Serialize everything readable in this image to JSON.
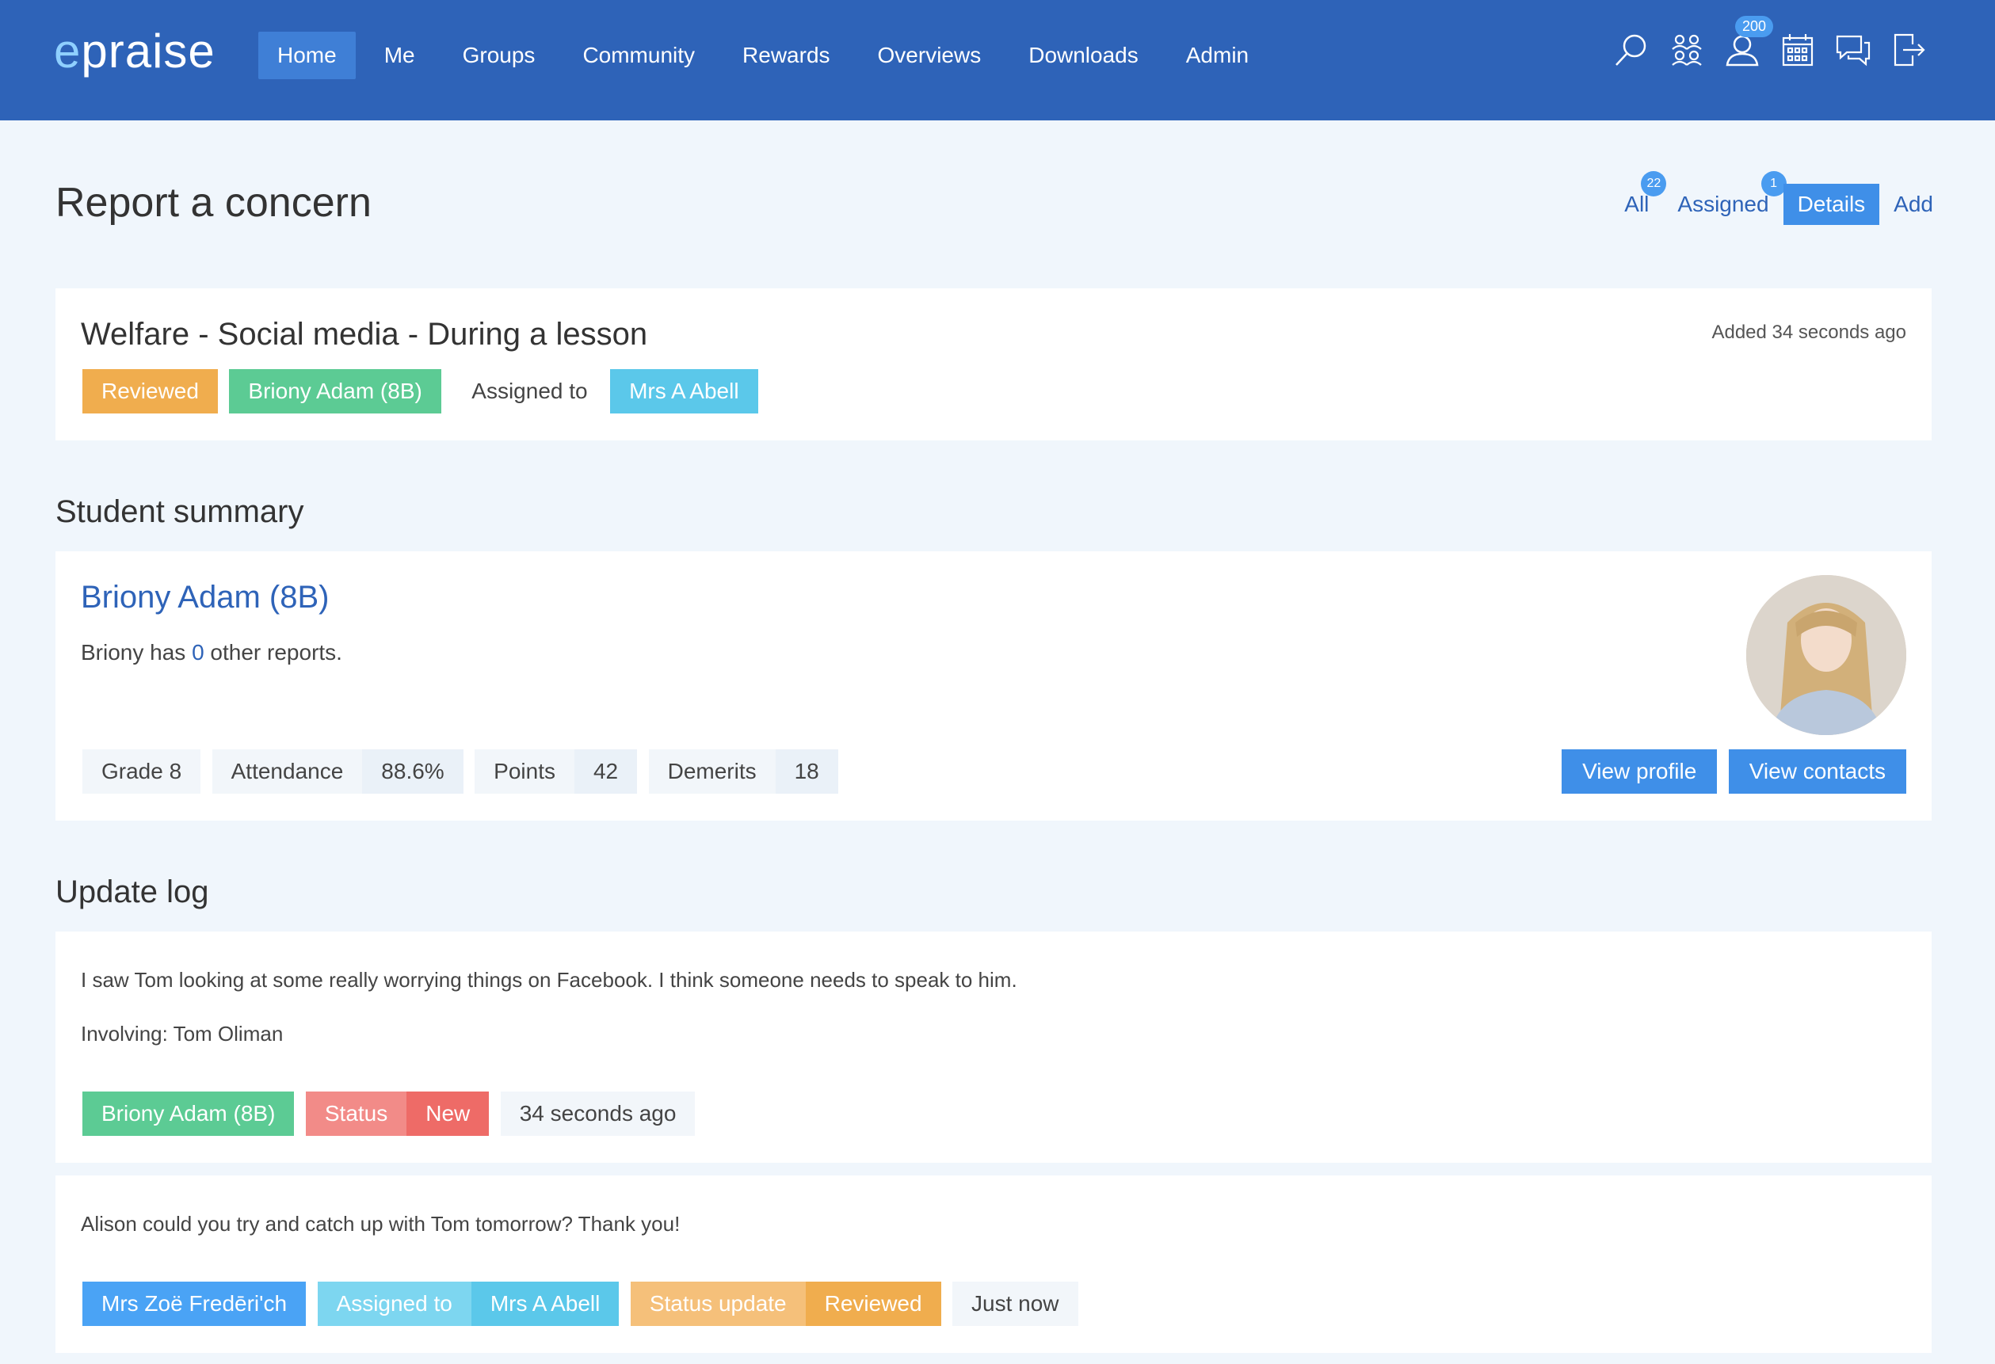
{
  "app": {
    "logo_e": "e",
    "logo_rest": "praise"
  },
  "nav": {
    "items": [
      "Home",
      "Me",
      "Groups",
      "Community",
      "Rewards",
      "Overviews",
      "Downloads",
      "Admin"
    ],
    "active": "Home"
  },
  "header_icons": {
    "notifications_badge": "200",
    "icons": [
      "search-icon",
      "groups-icon",
      "user-icon",
      "calendar-icon",
      "chat-icon",
      "logout-icon"
    ]
  },
  "page": {
    "title": "Report a concern"
  },
  "subnav": {
    "all_label": "All",
    "all_badge": "22",
    "assigned_label": "Assigned",
    "assigned_badge": "1",
    "details_label": "Details",
    "add_label": "Add"
  },
  "concern": {
    "title": "Welfare - Social media - During a lesson",
    "added": "Added 34 seconds ago",
    "status": "Reviewed",
    "student": "Briony Adam (8B)",
    "assigned_to_label": "Assigned to",
    "assignee": "Mrs A Abell"
  },
  "student_summary": {
    "section_title": "Student summary",
    "name": "Briony Adam",
    "form": "(8B)",
    "reports_prefix": "Briony has ",
    "reports_count": "0",
    "reports_suffix": " other reports.",
    "grade": "Grade 8",
    "attendance_label": "Attendance",
    "attendance_value": "88.6%",
    "points_label": "Points",
    "points_value": "42",
    "demerits_label": "Demerits",
    "demerits_value": "18",
    "view_profile": "View profile",
    "view_contacts": "View contacts"
  },
  "update_log": {
    "section_title": "Update log",
    "entries": [
      {
        "message": "I saw Tom looking at some really worrying things on Facebook. I think someone needs to speak to him.",
        "involving": "Involving: Tom Oliman",
        "author": "Briony Adam (8B)",
        "status_label": "Status",
        "status_value": "New",
        "time": "34 seconds ago"
      },
      {
        "message": "Alison could you try and catch up with Tom tomorrow? Thank you!",
        "author": "Mrs Zoë Fredēri'ch",
        "assigned_label": "Assigned to",
        "assigned_value": "Mrs A Abell",
        "status_update_label": "Status update",
        "status_update_value": "Reviewed",
        "time": "Just now"
      }
    ]
  },
  "colors": {
    "topbar": "#2e63b8",
    "background": "#f0f6fc",
    "link": "#2e63b8",
    "reviewed": "#f0ad4e",
    "student_tag": "#5ccb94",
    "assignee_tag": "#5bc8ea",
    "new_status": "#ee6b67",
    "button": "#3f8fe8"
  }
}
